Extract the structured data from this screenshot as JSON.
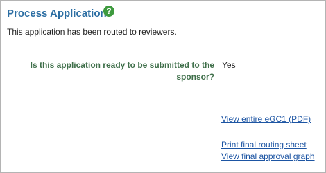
{
  "header": {
    "title": "Process Application",
    "help_icon": "?"
  },
  "status_message": "This application has been routed to reviewers.",
  "question": {
    "label": "Is this application ready to be submitted to the sponsor?",
    "answer": "Yes"
  },
  "links": {
    "view_pdf": "View entire eGC1 (PDF)",
    "print_routing": "Print final routing sheet",
    "view_graph": "View final approval graph"
  },
  "colors": {
    "title": "#2c6ea3",
    "help_icon": "#3e9a3e",
    "question_label": "#3f6f4a",
    "link": "#1d55a3",
    "border": "#b4b4b4"
  }
}
